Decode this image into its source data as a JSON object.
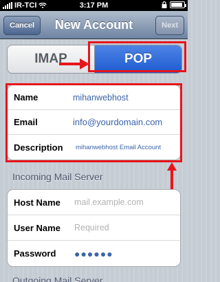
{
  "status_bar": {
    "carrier": "IR-TCI",
    "time": "3:17 PM",
    "battery_level": 0.9
  },
  "nav": {
    "cancel_label": "Cancel",
    "title": "New Account",
    "next_label": "Next"
  },
  "segments": [
    {
      "label": "IMAP",
      "selected": false
    },
    {
      "label": "POP",
      "selected": true
    }
  ],
  "account": {
    "name_label": "Name",
    "name_value": "mihanwebhost",
    "email_label": "Email",
    "email_value": "info@yourdomain.com",
    "description_label": "Description",
    "description_value": "mihanwebhost Email Account"
  },
  "incoming": {
    "header": "Incoming Mail Server",
    "host_label": "Host Name",
    "host_placeholder": "mail.example.com",
    "user_label": "User Name",
    "user_placeholder": "Required",
    "password_label": "Password",
    "password_value": "●●●●●●"
  },
  "outgoing": {
    "header": "Outgoing Mail Server"
  },
  "colors": {
    "highlight": "#e8141b",
    "value_text": "#3b64a8",
    "selected_segment": "#2a64d6"
  }
}
